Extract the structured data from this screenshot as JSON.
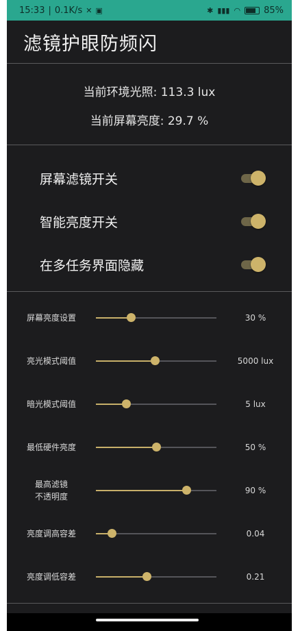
{
  "status_bar": {
    "time": "15:33",
    "net_speed": "0.1K/s",
    "battery": "85%"
  },
  "header": {
    "title": "滤镜护眼防频闪"
  },
  "info": {
    "ambient": "当前环境光照: 113.3 lux",
    "brightness": "当前屏幕亮度: 29.7 %"
  },
  "toggles": [
    {
      "label": "屏幕滤镜开关",
      "on": true
    },
    {
      "label": "智能亮度开关",
      "on": true
    },
    {
      "label": "在多任务界面隐藏",
      "on": true
    }
  ],
  "sliders": [
    {
      "label": "屏幕亮度设置",
      "value": "30 %",
      "fraction": 0.29
    },
    {
      "label": "亮光模式阈值",
      "value": "5000 lux",
      "fraction": 0.49
    },
    {
      "label": "暗光模式阈值",
      "value": "5 lux",
      "fraction": 0.25
    },
    {
      "label": "最低硬件亮度",
      "value": "50 %",
      "fraction": 0.5
    },
    {
      "label": "最高滤镜\n不透明度",
      "value": "90 %",
      "fraction": 0.75
    },
    {
      "label": "亮度调高容差",
      "value": "0.04",
      "fraction": 0.13
    },
    {
      "label": "亮度调低容差",
      "value": "0.21",
      "fraction": 0.42
    }
  ],
  "colors": {
    "accent": "#cdb36a",
    "background": "#1c1c1e",
    "status_bar": "#2aa78f"
  }
}
